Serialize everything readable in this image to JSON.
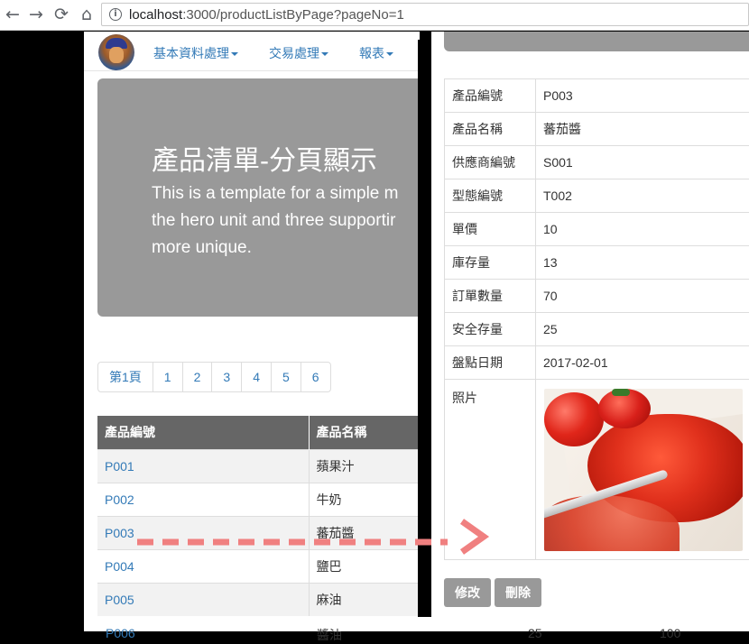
{
  "browser": {
    "back_glyph": "←",
    "forward_glyph": "→",
    "reload_glyph": "⟳",
    "home_glyph": "⌂",
    "info_glyph": "i",
    "url_host": "localhost",
    "url_rest": ":3000/productListByPage?pageNo=1"
  },
  "navbar": {
    "menu": [
      {
        "label": "基本資料處理"
      },
      {
        "label": "交易處理"
      },
      {
        "label": "報表"
      }
    ]
  },
  "hero": {
    "title": "產品清單-分頁顯示",
    "lines": [
      "This is a template for a simple m",
      "the hero unit and three supportir",
      "more unique."
    ]
  },
  "pagination": [
    "第1頁",
    "1",
    "2",
    "3",
    "4",
    "5",
    "6"
  ],
  "table": {
    "headers": [
      "產品編號",
      "產品名稱"
    ],
    "rows": [
      {
        "id": "P001",
        "name": "蘋果汁"
      },
      {
        "id": "P002",
        "name": "牛奶"
      },
      {
        "id": "P003",
        "name": "蕃茄醬"
      },
      {
        "id": "P004",
        "name": "鹽巴"
      },
      {
        "id": "P005",
        "name": "麻油"
      }
    ],
    "partial_row": {
      "id": "P006",
      "name": "醬油",
      "c3": "25",
      "c4": "100"
    }
  },
  "detail": {
    "fields": [
      {
        "label": "產品編號",
        "value": "P003"
      },
      {
        "label": "產品名稱",
        "value": "蕃茄醬"
      },
      {
        "label": "供應商編號",
        "value": "S001"
      },
      {
        "label": "型態編號",
        "value": "T002"
      },
      {
        "label": "單價",
        "value": "10"
      },
      {
        "label": "庫存量",
        "value": "13"
      },
      {
        "label": "訂單數量",
        "value": "70"
      },
      {
        "label": "安全存量",
        "value": "25"
      },
      {
        "label": "盤點日期",
        "value": "2017-02-01"
      }
    ],
    "photo_label": "照片",
    "edit_button": "修改",
    "delete_button": "刪除"
  },
  "colors": {
    "link": "#337ab7",
    "hero_bg": "#999999",
    "table_header_bg": "#666666",
    "arrow": "#f08080"
  }
}
